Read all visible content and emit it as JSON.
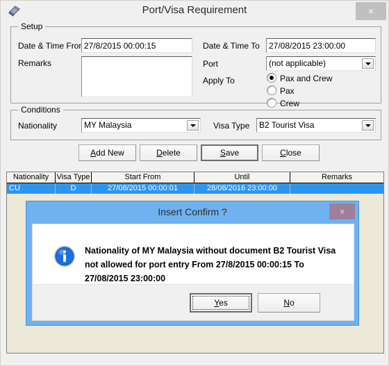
{
  "window": {
    "title": "Port/Visa Requirement",
    "app_icon": "document-arrow-icon",
    "close_label": "×"
  },
  "setup": {
    "legend": "Setup",
    "date_time_from_label": "Date & Time From",
    "date_time_from_value": "27/8/2015 00:00:15",
    "remarks_label": "Remarks",
    "remarks_value": "",
    "date_time_to_label": "Date & Time To",
    "date_time_to_value": "27/08/2015 23:00:00",
    "port_label": "Port",
    "port_value": "(not applicable)",
    "apply_to_label": "Apply To",
    "apply_to_options": [
      {
        "label": "Pax and Crew",
        "selected": true
      },
      {
        "label": "Pax",
        "selected": false
      },
      {
        "label": "Crew",
        "selected": false
      }
    ]
  },
  "conditions": {
    "legend": "Conditions",
    "nationality_label": "Nationality",
    "nationality_value": "MY Malaysia",
    "visa_type_label": "Visa Type",
    "visa_type_value": "B2 Tourist Visa"
  },
  "buttons": {
    "add_new": "Add New",
    "add_new_mnemonic": "A",
    "delete": "Delete",
    "delete_mnemonic": "D",
    "save": "Save",
    "save_mnemonic": "S",
    "close": "Close",
    "close_mnemonic": "C"
  },
  "grid": {
    "columns": [
      "Nationality",
      "Visa Type",
      "Start From",
      "Until",
      "Remarks"
    ],
    "rows": [
      {
        "nationality": "CU",
        "visa_type": "D",
        "start_from": "27/08/2015 00:00:01",
        "until": "28/08/2016 23:00:00",
        "remarks": "",
        "selected": true
      }
    ]
  },
  "dialog": {
    "title": "Insert Confirm ?",
    "close_label": "×",
    "icon": "info-icon",
    "message": "Nationality of MY Malaysia without document B2 Tourist Visa not allowed for port entry From 27/8/2015 00:00:15 To 27/08/2015 23:00:00",
    "yes_label": "Yes",
    "yes_mnemonic": "Y",
    "no_label": "No",
    "no_mnemonic": "N"
  },
  "colors": {
    "selection_blue": "#2e95ee",
    "dialog_frame_blue": "#6fb2ef",
    "grid_background": "#ece9d8",
    "window_background": "#f0f0f0"
  }
}
